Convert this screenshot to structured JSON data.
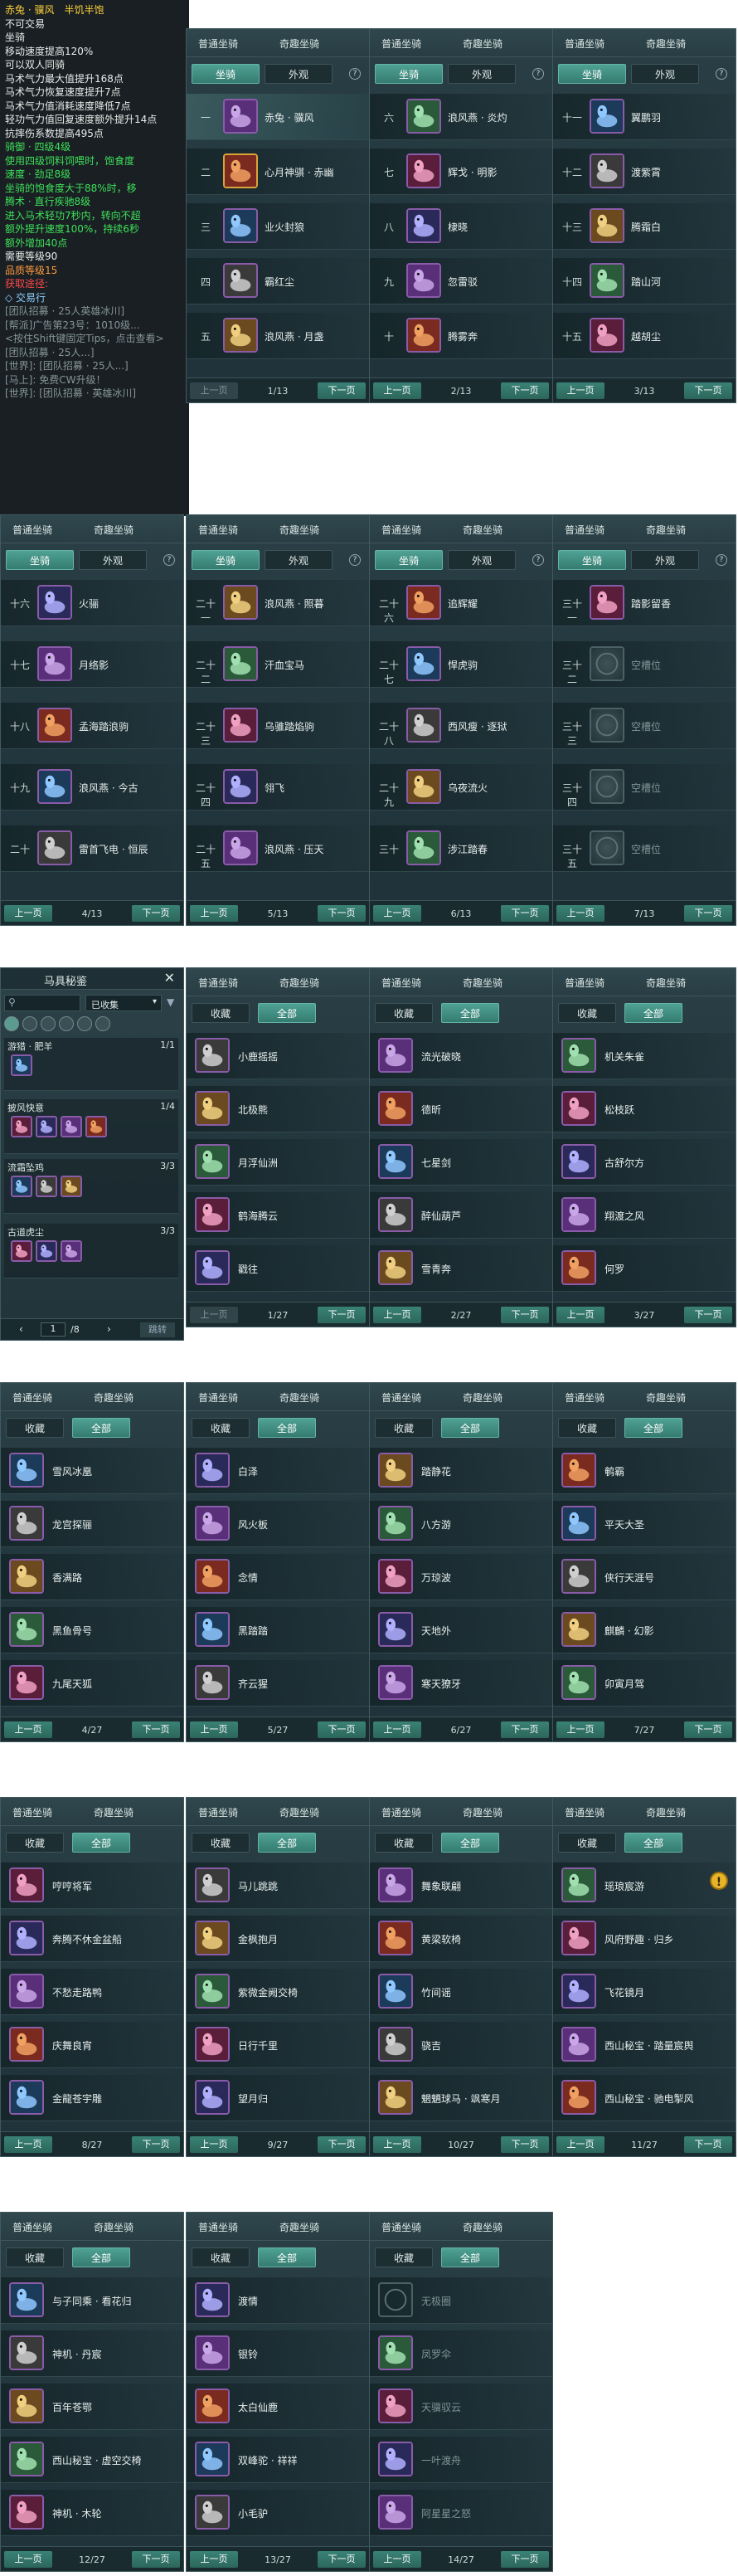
{
  "tabs": {
    "normal": "普通坐骑",
    "odd": "奇趣坐骑",
    "mount": "坐骑",
    "look": "外观",
    "collect": "收藏",
    "all": "全部",
    "help": "?"
  },
  "pager": {
    "prev": "上一页",
    "next": "下一页"
  },
  "tooltip": {
    "title": "赤兔 · 骥风",
    "hunger": "半饥半饱",
    "lines": [
      "不可交易",
      "坐骑",
      "移动速度提高120%",
      "可以双人同骑",
      "马术气力最大值提升168点",
      "马术气力恢复速度提升7点",
      "马术气力值消耗速度降低7点",
      "轻功气力值回复速度额外提升14点",
      "抗摔伤系数提高495点"
    ],
    "green_lines": [
      "骑御 · 四级4级",
      "使用四级饲料饲喂时，饱食度",
      "速度 · 劲足8级",
      "坐骑的饱食度大于88%时，移",
      "腾术 · 直行疾驰8级",
      "进入马术轻功7秒内，转向不超",
      "额外提升速度100%，持续6秒",
      "额外增加40点"
    ],
    "need_level": "需要等级90",
    "quality": "品质等级15",
    "source_label": "获取途径:",
    "trade": "◇ 交易行",
    "chat": [
      "[团队招募 · 25人英雄冰川]",
      "[帮派]广告第23号：1010级...",
      "<按住Shift键固定Tips，点击查看>",
      "[团队招募 · 25人...]",
      "[世界]: [团队招募 · 25人...]",
      "[马上]: 免费CW升级！",
      "[世界]: [团队招募 · 英雄冰川]"
    ]
  },
  "mount_pages": [
    {
      "count": "1/13",
      "items": [
        {
          "num": "一",
          "name": "赤兔 · 骥风"
        },
        {
          "num": "二",
          "name": "心月神骐 · 赤幽"
        },
        {
          "num": "三",
          "name": "业火封狼"
        },
        {
          "num": "四",
          "name": "霸红尘"
        },
        {
          "num": "五",
          "name": "浪风燕 · 月盏"
        }
      ]
    },
    {
      "count": "2/13",
      "items": [
        {
          "num": "六",
          "name": "浪风燕 · 炎灼"
        },
        {
          "num": "七",
          "name": "辉戈 · 明影"
        },
        {
          "num": "八",
          "name": "棣晓"
        },
        {
          "num": "九",
          "name": "忽雷驳"
        },
        {
          "num": "十",
          "name": "腾雾奔"
        }
      ]
    },
    {
      "count": "3/13",
      "items": [
        {
          "num": "十一",
          "name": "翼鹏羽"
        },
        {
          "num": "十二",
          "name": "渡紫霄"
        },
        {
          "num": "十三",
          "name": "腾霜白"
        },
        {
          "num": "十四",
          "name": "踏山河"
        },
        {
          "num": "十五",
          "name": "越胡尘"
        }
      ]
    },
    {
      "count": "4/13",
      "items": [
        {
          "num": "十六",
          "name": "火骊"
        },
        {
          "num": "十七",
          "name": "月络影"
        },
        {
          "num": "十八",
          "name": "孟海踏浪驹"
        },
        {
          "num": "十九",
          "name": "浪风燕 · 今古"
        },
        {
          "num": "二十",
          "name": "雷首飞电 · 恒辰"
        }
      ]
    },
    {
      "count": "5/13",
      "items": [
        {
          "num": "二十一",
          "name": "浪风燕 · 照暮"
        },
        {
          "num": "二十二",
          "name": "汗血宝马"
        },
        {
          "num": "二十三",
          "name": "乌骓踏焰驹"
        },
        {
          "num": "二十四",
          "name": "翎飞"
        },
        {
          "num": "二十五",
          "name": "浪风燕 · 压天"
        }
      ]
    },
    {
      "count": "6/13",
      "items": [
        {
          "num": "二十六",
          "name": "追辉耀"
        },
        {
          "num": "二十七",
          "name": "悍虎驹"
        },
        {
          "num": "二十八",
          "name": "西风瘦 · 逐狱"
        },
        {
          "num": "二十九",
          "name": "乌夜流火"
        },
        {
          "num": "三十",
          "name": "涉江踏春"
        }
      ]
    },
    {
      "count": "7/13",
      "items": [
        {
          "num": "三十一",
          "name": "踏影留香"
        },
        {
          "num": "三十二",
          "name": "空槽位"
        },
        {
          "num": "三十三",
          "name": "空槽位"
        },
        {
          "num": "三十四",
          "name": "空槽位"
        },
        {
          "num": "三十五",
          "name": "空槽位"
        }
      ]
    }
  ],
  "saddle_book": {
    "title": "马具秘鉴",
    "filter": "已收集",
    "groups": [
      {
        "name": "游猎 · 肥羊",
        "count": "1/1"
      },
      {
        "name": "披风快意",
        "count": "1/4"
      },
      {
        "name": "流霜坠鸡",
        "count": "3/3"
      },
      {
        "name": "古道虎尘",
        "count": "3/3"
      }
    ],
    "page": "1",
    "total": "/8",
    "jump": "跳转"
  },
  "odd_pages": [
    {
      "count": "1/27",
      "items": [
        "小鹿摇摇",
        "北极熊",
        "月浮仙洲",
        "鹤海腾云",
        "戳往"
      ]
    },
    {
      "count": "2/27",
      "items": [
        "流光破晓",
        "德昕",
        "七星剑",
        "醉仙葫芦",
        "雪青奔"
      ]
    },
    {
      "count": "3/27",
      "items": [
        "机关朱雀",
        "松枝跃",
        "古舒尔方",
        "翔渡之风",
        "何罗"
      ]
    },
    {
      "count": "4/27",
      "items": [
        "雪风冰凰",
        "龙宫探骊",
        "香满路",
        "黑鱼骨号",
        "九尾天狐"
      ]
    },
    {
      "count": "5/27",
      "items": [
        "白泽",
        "风火板",
        "念情",
        "黑踏踏",
        "齐云猩"
      ]
    },
    {
      "count": "6/27",
      "items": [
        "踏静花",
        "八方游",
        "万琼波",
        "天地外",
        "寒天獠牙"
      ]
    },
    {
      "count": "7/27",
      "items": [
        "鹌霸",
        "平天大圣",
        "侠行天涯号",
        "麒麟 · 幻影",
        "卯寅月驾"
      ]
    },
    {
      "count": "8/27",
      "items": [
        "哼哼将军",
        "奔腾不休金盆船",
        "不愁走路鸭",
        "庆舞良宵",
        "金龍苍宇雕"
      ]
    },
    {
      "count": "9/27",
      "items": [
        "马儿跳跳",
        "金枫抱月",
        "紫微金阙交椅",
        "日行千里",
        "望月归"
      ]
    },
    {
      "count": "10/27",
      "items": [
        "舞象联翩",
        "黄梁软椅",
        "竹间谣",
        "骁吉",
        "魍魉球马 · 飒寒月"
      ]
    },
    {
      "count": "11/27",
      "items": [
        "瑶琅宸游",
        "风府野趣 · 归乡",
        "飞花镜月",
        "西山秘宝 · 踏量宸舆",
        "西山秘宝 · 驰电掣风"
      ]
    },
    {
      "count": "12/27",
      "items": [
        "与子同乘 · 看花归",
        "神机 · 丹宸",
        "百年苍鄂",
        "西山秘宝 · 虚空交椅",
        "神机 · 木轮"
      ]
    },
    {
      "count": "13/27",
      "items": [
        "渡情",
        "银铃",
        "太白仙鹿",
        "双峰驼 · 祥祥",
        "小毛驴"
      ]
    },
    {
      "count": "14/27",
      "items": [
        "无极圈",
        "凤罗伞",
        "天骥驭云",
        "一叶渡舟",
        "阿星星之怒"
      ]
    }
  ],
  "colors": {
    "accent": "#3a8276",
    "panel_bg": "#243840",
    "border_purple": "#8a5ba8",
    "border_gold": "#d9a43a",
    "tooltip_yellow": "#ffd23e",
    "tooltip_green": "#3fe05a",
    "tooltip_red": "#ff4a4a"
  }
}
